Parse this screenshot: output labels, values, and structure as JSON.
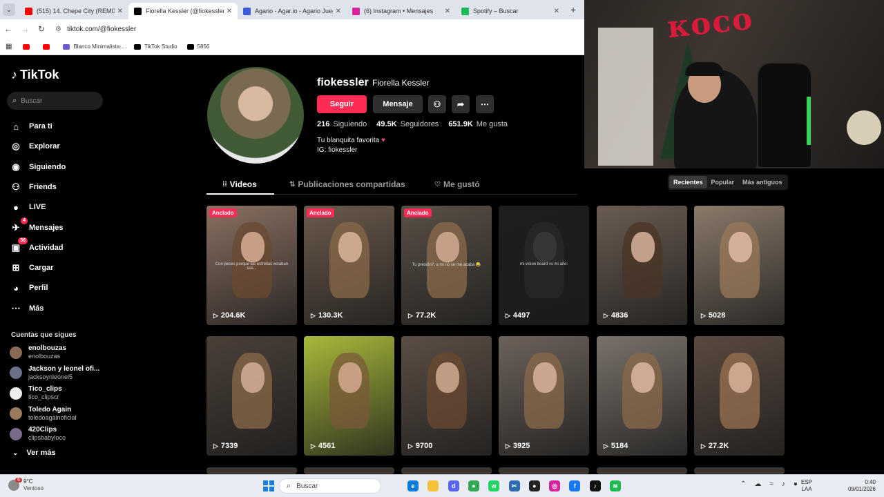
{
  "browser": {
    "tabs": [
      {
        "title": "(515) 14. Chepe City (REMIX) ft",
        "favicon_color": "#ff0000"
      },
      {
        "title": "Fiorella Kessler (@fiokessler) | T",
        "favicon_color": "#000000",
        "active": true
      },
      {
        "title": "Agario - Agar.io - Agario Juego",
        "favicon_color": "#3b5bdb"
      },
      {
        "title": "(6) Instagram • Mensajes",
        "favicon_color": "#d6249f"
      },
      {
        "title": "Spotify – Buscar",
        "favicon_color": "#1db954"
      }
    ],
    "new_tab": "+",
    "url": "tiktok.com/@fiokessler",
    "bookmarks": [
      {
        "label": "",
        "color": "#ff0000"
      },
      {
        "label": "",
        "color": "#ff0000"
      },
      {
        "label": "Blanco Minimalista...",
        "color": "#6b5bd2"
      },
      {
        "label": "TikTok Studio",
        "color": "#000000"
      },
      {
        "label": "5856",
        "color": "#000000"
      }
    ]
  },
  "sidebar": {
    "logo": "TikTok",
    "search_placeholder": "Buscar",
    "nav": [
      {
        "label": "Para ti",
        "icon": "home-icon"
      },
      {
        "label": "Explorar",
        "icon": "compass-icon"
      },
      {
        "label": "Siguiendo",
        "icon": "following-icon"
      },
      {
        "label": "Friends",
        "icon": "friends-icon"
      },
      {
        "label": "LIVE",
        "icon": "live-icon"
      },
      {
        "label": "Mensajes",
        "icon": "messages-icon",
        "badge": "4"
      },
      {
        "label": "Actividad",
        "icon": "activity-icon",
        "badge": "36"
      },
      {
        "label": "Cargar",
        "icon": "upload-icon"
      },
      {
        "label": "Perfil",
        "icon": "profile-icon"
      },
      {
        "label": "Más",
        "icon": "more-icon"
      }
    ],
    "following_title": "Cuentas que sigues",
    "following": [
      {
        "name": "enolbouzas",
        "handle": "enolbouzas",
        "color": "#8a6a55"
      },
      {
        "name": "Jackson y leonel ofi...",
        "handle": "jacksoynleonel5",
        "color": "#6a6f8a"
      },
      {
        "name": "Tico_clips",
        "handle": "tico_clipscr",
        "color": "#eeeeee"
      },
      {
        "name": "Toledo Again",
        "handle": "toledoagainoficial",
        "color": "#9a7a5a"
      },
      {
        "name": "420Clips",
        "handle": "clipsbabyloco",
        "color": "#7a6a8a"
      }
    ],
    "see_more": "Ver más"
  },
  "profile": {
    "username": "fiokessler",
    "display_name": "Fiorella Kessler",
    "follow_label": "Seguir",
    "message_label": "Mensaje",
    "stats": [
      {
        "value": "216",
        "label": "Siguiendo"
      },
      {
        "value": "49.5K",
        "label": "Seguidores"
      },
      {
        "value": "651.9K",
        "label": "Me gusta"
      }
    ],
    "bio_line1": "Tu blanquita favorita",
    "bio_heart": "♥",
    "bio_line2": "IG: fiokessler",
    "tabs": [
      "Videos",
      "Publicaciones compartidas",
      "Me gustó"
    ],
    "sort": [
      "Recientes",
      "Popular",
      "Más antiguos"
    ]
  },
  "videos": [
    {
      "views": "204.6K",
      "pinned": "Anclado",
      "caption": "Con peces porque las estrellas estaban sus...",
      "bg": "#8a7062",
      "hair": "#6a4a32",
      "face": "#d9ad94"
    },
    {
      "views": "130.3K",
      "pinned": "Anclado",
      "caption": "",
      "bg": "#6b5a4c",
      "hair": "#8a6a4a",
      "face": "#dbb59c"
    },
    {
      "views": "77.2K",
      "pinned": "Anclado",
      "caption": "Tu presión?, a mi no se me acaba 😂",
      "bg": "#5a5046",
      "hair": "#8b6b4b",
      "face": "#d4ab92"
    },
    {
      "views": "4497",
      "pinned": "",
      "caption": "mi vision board vs mi año:",
      "bg": "#1e1e20",
      "hair": "#2a2a2a",
      "face": "#3a3a3a"
    },
    {
      "views": "4836",
      "pinned": "",
      "caption": "",
      "bg": "#6a5c52",
      "hair": "#4a3426",
      "face": "#d7b39e"
    },
    {
      "views": "5028",
      "pinned": "",
      "caption": "",
      "bg": "#8a7a6a",
      "hair": "#9a7a5a",
      "face": "#e0bba4"
    },
    {
      "views": "7339",
      "pinned": "",
      "caption": "",
      "bg": "#4a4038",
      "hair": "#8a6a4a",
      "face": "#d3ae95"
    },
    {
      "views": "4561",
      "pinned": "",
      "caption": "",
      "bg": "#a8b83a",
      "hair": "#7a5a3a",
      "face": "#d5a98f"
    },
    {
      "views": "9700",
      "pinned": "",
      "caption": "",
      "bg": "#5c4e44",
      "hair": "#6a4a32",
      "face": "#d2ab93"
    },
    {
      "views": "3925",
      "pinned": "",
      "caption": "",
      "bg": "#6c625a",
      "hair": "#8a6a4a",
      "face": "#d8b29c"
    },
    {
      "views": "5184",
      "pinned": "",
      "caption": "",
      "bg": "#7a726a",
      "hair": "#8a6a4a",
      "face": "#dcb7a0"
    },
    {
      "views": "27.2K",
      "pinned": "",
      "caption": "",
      "bg": "#5a4a40",
      "hair": "#9a7252",
      "face": "#d9b29a"
    }
  ],
  "taskbar": {
    "weather_badge": "6",
    "temp": "9°C",
    "condition": "Ventoso",
    "search": "Buscar",
    "lang1": "ESP",
    "lang2": "LAA",
    "time": "0:40",
    "date": "09/01/2026",
    "apps": [
      {
        "name": "edge-icon",
        "color": "#0c7bd8",
        "glyph": "e"
      },
      {
        "name": "folder-icon",
        "color": "#f4c23a",
        "glyph": ""
      },
      {
        "name": "discord-icon",
        "color": "#5865f2",
        "glyph": "d"
      },
      {
        "name": "chrome-icon",
        "color": "#34a853",
        "glyph": "●"
      },
      {
        "name": "whatsapp-icon",
        "color": "#25d366",
        "glyph": "w"
      },
      {
        "name": "snipping-icon",
        "color": "#2b6cb0",
        "glyph": "✂"
      },
      {
        "name": "obs-icon",
        "color": "#222222",
        "glyph": "●"
      },
      {
        "name": "instagram-icon",
        "color": "#d6249f",
        "glyph": "◎"
      },
      {
        "name": "facebook-icon",
        "color": "#1877f2",
        "glyph": "f"
      },
      {
        "name": "tiktok-icon",
        "color": "#111111",
        "glyph": "♪"
      },
      {
        "name": "spotify-icon",
        "color": "#1db954",
        "glyph": "≋"
      }
    ]
  }
}
